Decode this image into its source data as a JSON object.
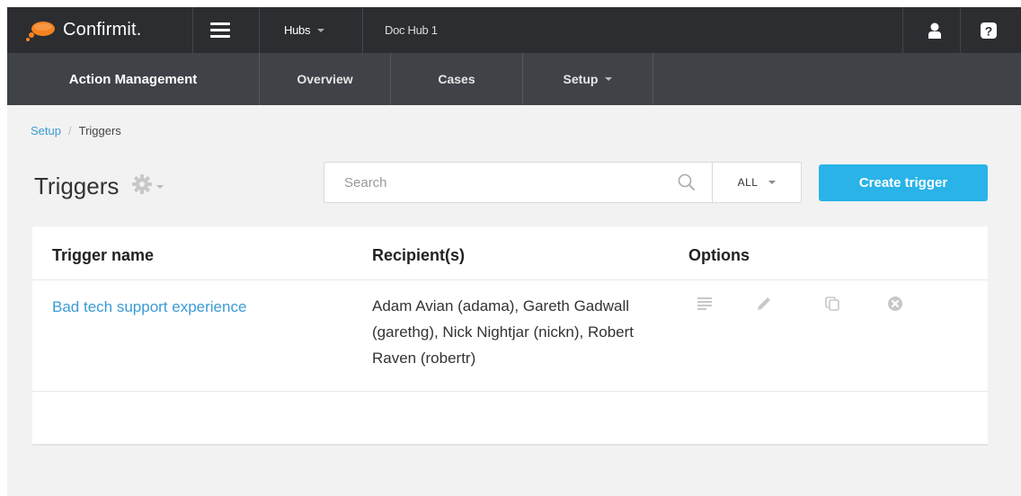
{
  "app": {
    "logo_text": "Confirmit.",
    "hubs_label": "Hubs",
    "hub_name": "Doc Hub 1"
  },
  "subnav": {
    "section_title": "Action Management",
    "tabs": [
      {
        "label": "Overview"
      },
      {
        "label": "Cases"
      },
      {
        "label": "Setup"
      }
    ]
  },
  "breadcrumb": {
    "parent": "Setup",
    "separator": "/",
    "current": "Triggers"
  },
  "page": {
    "title": "Triggers"
  },
  "search": {
    "placeholder": "Search",
    "filter_value": "ALL"
  },
  "actions": {
    "create_label": "Create trigger"
  },
  "table": {
    "headers": [
      "Trigger name",
      "Recipient(s)",
      "Options"
    ],
    "rows": [
      {
        "name": "Bad tech support experience",
        "recipients": "Adam Avian (adama), Gareth Gadwall (garethg), Nick Nightjar (nickn), Robert Raven (robertr)"
      }
    ]
  },
  "colors": {
    "topbar": "#2b2d31",
    "subbar": "#3f4247",
    "accent": "#29b3e8",
    "link": "#3a9bd5"
  },
  "icons": [
    "logo-icon",
    "menu-icon",
    "user-icon",
    "help-icon",
    "gear-icon",
    "search-icon",
    "details-icon",
    "edit-icon",
    "copy-icon",
    "delete-icon"
  ]
}
